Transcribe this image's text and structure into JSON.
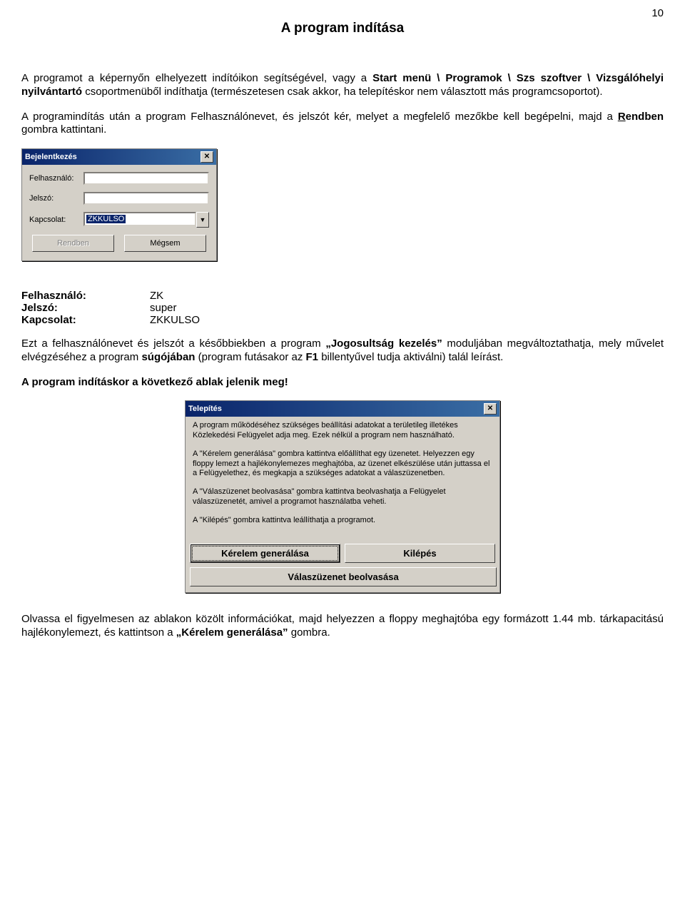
{
  "page_number": "10",
  "title": "A program indítása",
  "paragraphs": {
    "p1_a": "A programot a képernyőn elhelyezett indítóikon segítségével, vagy a ",
    "p1_b": "Start menü \\ Programok \\ Szs szoftver \\ Vizsgálóhelyi nyilvántartó",
    "p1_c": " csoportmenüből indíthatja (természetesen csak akkor, ha telepítéskor nem választott más programcsoportot).",
    "p2_a": "A programindítás után a program Felhasználónevet, és jelszót kér, melyet a megfelelő mezőkbe kell begépelni, majd a ",
    "p2_b": "R",
    "p2_c": "endben",
    "p2_d": " gombra kattintani."
  },
  "login": {
    "title": "Bejelentkezés",
    "label_user": "Felhasználó:",
    "label_pass": "Jelszó:",
    "label_conn": "Kapcsolat:",
    "conn_value": "ZKKULSO",
    "btn_ok": "Rendben",
    "btn_cancel": "Mégsem"
  },
  "credentials": {
    "user_label": "Felhasználó:",
    "user_value": "ZK",
    "pass_label": "Jelszó:",
    "pass_value": "super",
    "conn_label": "Kapcsolat:",
    "conn_value": "ZKKULSO"
  },
  "paragraphs2": {
    "p3_a": "Ezt a felhasználónevet és jelszót a későbbiekben a program ",
    "p3_b": "„Jogosultság kezelés”",
    "p3_c": " moduljában megváltoztathatja, mely művelet elvégzéséhez a program ",
    "p3_d": "súgójában",
    "p3_e": " (program futásakor az ",
    "p3_f": "F1",
    "p3_g": " billentyűvel tudja aktiválni) talál leírást.",
    "p4": "A program indításkor a következő ablak jelenik meg!"
  },
  "install": {
    "title": "Telepítés",
    "line1": "A program működéséhez szükséges beállítási adatokat a területileg illetékes Közlekedési Felügyelet adja meg. Ezek nélkül a program nem használható.",
    "line2": "A \"Kérelem generálása\" gombra kattintva előállíthat egy üzenetet. Helyezzen egy floppy lemezt a hajlékonylemezes meghajtóba, az üzenet elkészülése után juttassa el a Felügyelethez, és megkapja a szükséges adatokat a válaszüzenetben.",
    "line3": "A \"Válaszüzenet beolvasása\" gombra kattintva beolvashatja a Felügyelet válaszüzenetét, amivel a programot használatba veheti.",
    "line4": "A \"Kilépés\" gombra kattintva leállíthatja a programot.",
    "btn_generate": "Kérelem generálása",
    "btn_exit": "Kilépés",
    "btn_read": "Válaszüzenet beolvasása"
  },
  "closing": {
    "a": "Olvassa el figyelmesen az ablakon közölt információkat, majd helyezzen a floppy meghajtóba egy formázott 1.44 mb. tárkapacitású hajlékonylemezt, és kattintson a ",
    "b": "„Kérelem generálása”",
    "c": " gombra."
  }
}
